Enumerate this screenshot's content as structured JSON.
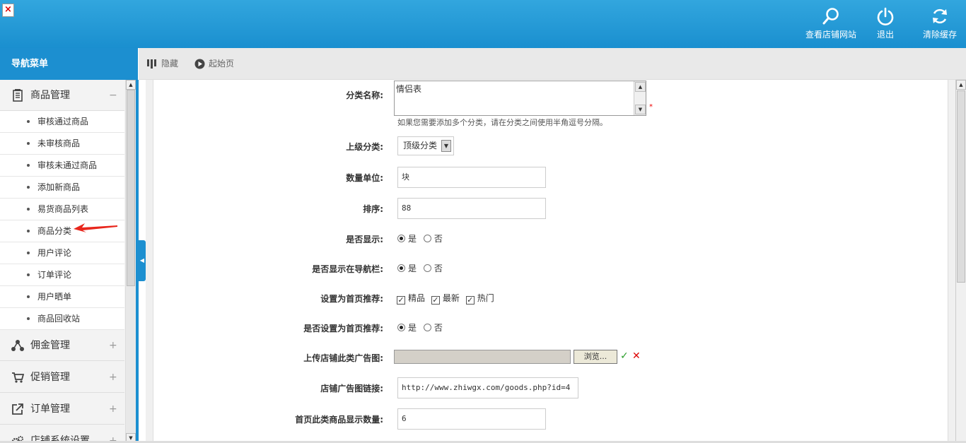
{
  "header": {
    "view_shop": "查看店铺网站",
    "logout": "退出",
    "clear_cache": "清除缓存"
  },
  "nav": {
    "title": "导航菜单",
    "groups": [
      {
        "label": "商品管理",
        "sign": "−"
      },
      {
        "label": "佣金管理",
        "sign": "+"
      },
      {
        "label": "促销管理",
        "sign": "+"
      },
      {
        "label": "订单管理",
        "sign": "+"
      },
      {
        "label": "店铺系统设置",
        "sign": "+"
      }
    ],
    "items": [
      "审核通过商品",
      "未审核商品",
      "审核未通过商品",
      "添加新商品",
      "易货商品列表",
      "商品分类",
      "用户评论",
      "订单评论",
      "用户晒单",
      "商品回收站"
    ]
  },
  "toolbar": {
    "hide": "隐藏",
    "home": "起始页"
  },
  "form": {
    "category_name_label": "分类名称:",
    "category_name_value": "情侣表",
    "required_mark": "*",
    "category_hint": "如果您需要添加多个分类，请在分类之间使用半角逗号分隔。",
    "parent_label": "上级分类:",
    "parent_value": "顶级分类",
    "unit_label": "数量单位:",
    "unit_value": "块",
    "sort_label": "排序:",
    "sort_value": "88",
    "show_label": "是否显示:",
    "show_in_nav_label": "是否显示在导航栏:",
    "recommend_label": "设置为首页推荐:",
    "recommend_options": [
      "精品",
      "最新",
      "热门"
    ],
    "set_home_label": "是否设置为首页推荐:",
    "yes": "是",
    "no": "否",
    "upload_label": "上传店铺此类广告图:",
    "browse": "浏览...",
    "ad_link_label": "店铺广告图链接:",
    "ad_link_value": "http://www.zhiwgx.com/goods.php?id=4",
    "home_count_label": "首页此类商品显示数量:",
    "home_count_value": "6"
  },
  "colors": {
    "header_blue": "#1a8fcf",
    "arrow_red": "#e8261c"
  }
}
